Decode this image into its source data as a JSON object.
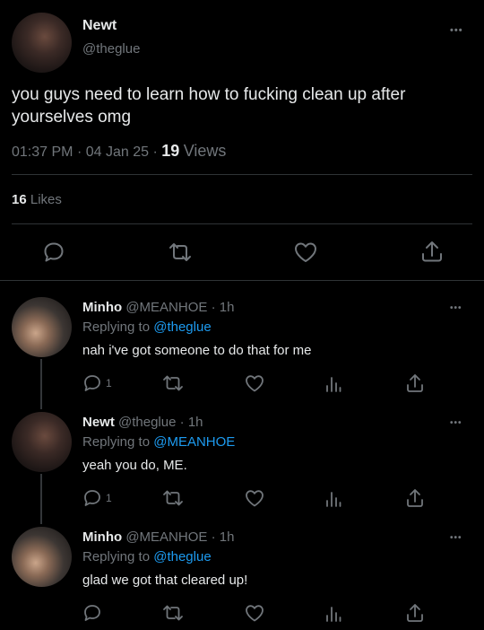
{
  "main_tweet": {
    "name": "Newt",
    "handle": "@theglue",
    "more": "•••",
    "text": "you guys need to learn how to fucking clean up after yourselves omg",
    "time": "01:37 PM",
    "sep1": "·",
    "date": "04 Jan 25",
    "sep2": "·",
    "views_count": "19",
    "views_label": "Views",
    "likes_count": "16",
    "likes_label": "Likes"
  },
  "replies": [
    {
      "name": "Minho",
      "handle": "@MEANHOE",
      "sep": "·",
      "age": "1h",
      "replying_prefix": "Replying to",
      "replying_to": "@theglue",
      "text": "nah i've got someone to do that for me",
      "reply_count": "1",
      "more": "•••"
    },
    {
      "name": "Newt",
      "handle": "@theglue",
      "sep": "·",
      "age": "1h",
      "replying_prefix": "Replying to",
      "replying_to": "@MEANHOE",
      "text": "yeah you do, ME.",
      "reply_count": "1",
      "more": "•••"
    },
    {
      "name": "Minho",
      "handle": "@MEANHOE",
      "sep": "·",
      "age": "1h",
      "replying_prefix": "Replying to",
      "replying_to": "@theglue",
      "text": "glad we got that cleared up!",
      "reply_count": "",
      "more": "•••"
    }
  ],
  "icons": {
    "reply": "reply-icon",
    "retweet": "retweet-icon",
    "like": "heart-icon",
    "share": "share-icon",
    "views": "views-icon",
    "more": "more-icon"
  },
  "colors": {
    "background": "#000000",
    "text": "#e7e9ea",
    "secondary": "#71767b",
    "accent": "#1d9bf0",
    "divider": "#2f3336"
  }
}
